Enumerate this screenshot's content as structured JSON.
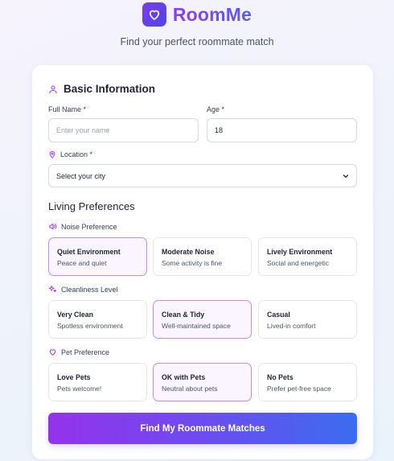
{
  "app": {
    "name": "RoomMe",
    "tagline": "Find your perfect roommate match"
  },
  "basic": {
    "heading": "Basic Information",
    "full_name": {
      "label": "Full Name *",
      "placeholder": "Enter your name",
      "value": ""
    },
    "age": {
      "label": "Age *",
      "value": "18"
    },
    "location": {
      "label": "Location *",
      "selected": "Select your city"
    }
  },
  "preferences": {
    "heading": "Living Preferences",
    "noise": {
      "label": "Noise Preference",
      "options": [
        {
          "title": "Quiet Environment",
          "desc": "Peace and quiet",
          "selected": true
        },
        {
          "title": "Moderate Noise",
          "desc": "Some activity is fine",
          "selected": false
        },
        {
          "title": "Lively Environment",
          "desc": "Social and energetic",
          "selected": false
        }
      ]
    },
    "cleanliness": {
      "label": "Cleanliness Level",
      "options": [
        {
          "title": "Very Clean",
          "desc": "Spotless environment",
          "selected": false
        },
        {
          "title": "Clean & Tidy",
          "desc": "Well-maintained space",
          "selected": true
        },
        {
          "title": "Casual",
          "desc": "Lived-in comfort",
          "selected": false
        }
      ]
    },
    "pets": {
      "label": "Pet Preference",
      "options": [
        {
          "title": "Love Pets",
          "desc": "Pets welcome!",
          "selected": false
        },
        {
          "title": "OK with Pets",
          "desc": "Neutral about pets",
          "selected": true
        },
        {
          "title": "No Pets",
          "desc": "Prefer pet-free space",
          "selected": false
        }
      ]
    }
  },
  "submit_label": "Find My Roommate Matches",
  "colors": {
    "accent": "#8b3ff0",
    "selected_border": "#c58af0",
    "selected_bg": "#fbf5ff",
    "cta_start": "#9333ea",
    "cta_end": "#3b6cf0"
  },
  "icons": {
    "logo": "heart-icon",
    "basic": "user-icon",
    "location": "map-pin-icon",
    "noise": "volume-icon",
    "cleanliness": "sparkles-icon",
    "pets": "heart-icon",
    "select": "chevron-down-icon"
  }
}
